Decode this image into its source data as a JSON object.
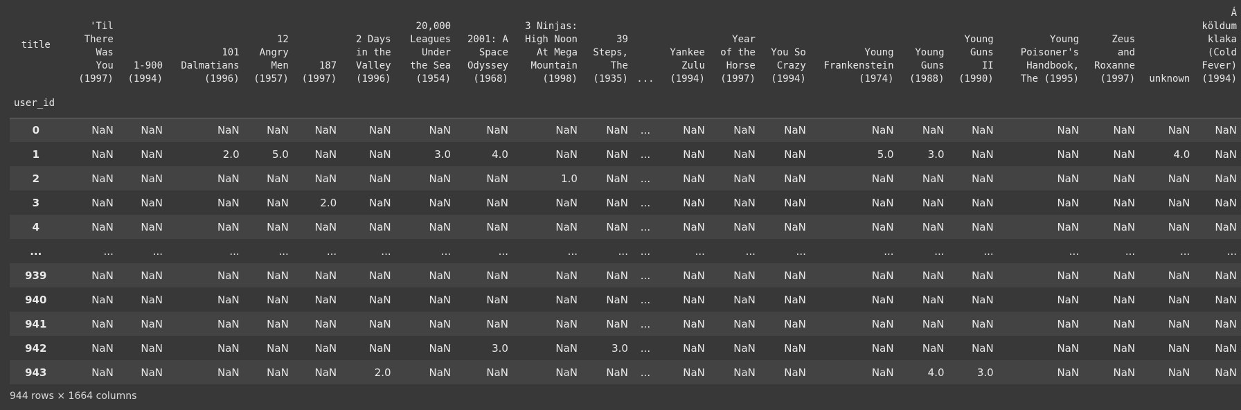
{
  "table": {
    "corner_label": "title",
    "index_name": "user_id",
    "columns": [
      "'Til\nThere\nWas\nYou\n(1997)",
      "1-900\n(1994)",
      "101\nDalmatians\n(1996)",
      "12\nAngry\nMen\n(1957)",
      "187\n(1997)",
      "2 Days\nin the\nValley\n(1996)",
      "20,000\nLeagues\nUnder\nthe Sea\n(1954)",
      "2001: A\nSpace\nOdyssey\n(1968)",
      "3 Ninjas:\nHigh Noon\nAt Mega\nMountain\n(1998)",
      "39\nSteps,\nThe\n(1935)",
      "...",
      "Yankee\nZulu\n(1994)",
      "Year\nof the\nHorse\n(1997)",
      "You So\nCrazy\n(1994)",
      "Young\nFrankenstein\n(1974)",
      "Young\nGuns\n(1988)",
      "Young\nGuns\nII\n(1990)",
      "Young\nPoisoner's\nHandbook,\nThe (1995)",
      "Zeus\nand\nRoxanne\n(1997)",
      "unknown",
      "Á\nköldum\nklaka\n(Cold\nFever)\n(1994)"
    ],
    "rows": [
      {
        "index": "0",
        "values": [
          "NaN",
          "NaN",
          "NaN",
          "NaN",
          "NaN",
          "NaN",
          "NaN",
          "NaN",
          "NaN",
          "NaN",
          "...",
          "NaN",
          "NaN",
          "NaN",
          "NaN",
          "NaN",
          "NaN",
          "NaN",
          "NaN",
          "NaN",
          "NaN"
        ]
      },
      {
        "index": "1",
        "values": [
          "NaN",
          "NaN",
          "2.0",
          "5.0",
          "NaN",
          "NaN",
          "3.0",
          "4.0",
          "NaN",
          "NaN",
          "...",
          "NaN",
          "NaN",
          "NaN",
          "5.0",
          "3.0",
          "NaN",
          "NaN",
          "NaN",
          "4.0",
          "NaN"
        ]
      },
      {
        "index": "2",
        "values": [
          "NaN",
          "NaN",
          "NaN",
          "NaN",
          "NaN",
          "NaN",
          "NaN",
          "NaN",
          "1.0",
          "NaN",
          "...",
          "NaN",
          "NaN",
          "NaN",
          "NaN",
          "NaN",
          "NaN",
          "NaN",
          "NaN",
          "NaN",
          "NaN"
        ]
      },
      {
        "index": "3",
        "values": [
          "NaN",
          "NaN",
          "NaN",
          "NaN",
          "2.0",
          "NaN",
          "NaN",
          "NaN",
          "NaN",
          "NaN",
          "...",
          "NaN",
          "NaN",
          "NaN",
          "NaN",
          "NaN",
          "NaN",
          "NaN",
          "NaN",
          "NaN",
          "NaN"
        ]
      },
      {
        "index": "4",
        "values": [
          "NaN",
          "NaN",
          "NaN",
          "NaN",
          "NaN",
          "NaN",
          "NaN",
          "NaN",
          "NaN",
          "NaN",
          "...",
          "NaN",
          "NaN",
          "NaN",
          "NaN",
          "NaN",
          "NaN",
          "NaN",
          "NaN",
          "NaN",
          "NaN"
        ]
      },
      {
        "index": "...",
        "values": [
          "...",
          "...",
          "...",
          "...",
          "...",
          "...",
          "...",
          "...",
          "...",
          "...",
          "...",
          "...",
          "...",
          "...",
          "...",
          "...",
          "...",
          "...",
          "...",
          "...",
          "..."
        ]
      },
      {
        "index": "939",
        "values": [
          "NaN",
          "NaN",
          "NaN",
          "NaN",
          "NaN",
          "NaN",
          "NaN",
          "NaN",
          "NaN",
          "NaN",
          "...",
          "NaN",
          "NaN",
          "NaN",
          "NaN",
          "NaN",
          "NaN",
          "NaN",
          "NaN",
          "NaN",
          "NaN"
        ]
      },
      {
        "index": "940",
        "values": [
          "NaN",
          "NaN",
          "NaN",
          "NaN",
          "NaN",
          "NaN",
          "NaN",
          "NaN",
          "NaN",
          "NaN",
          "...",
          "NaN",
          "NaN",
          "NaN",
          "NaN",
          "NaN",
          "NaN",
          "NaN",
          "NaN",
          "NaN",
          "NaN"
        ]
      },
      {
        "index": "941",
        "values": [
          "NaN",
          "NaN",
          "NaN",
          "NaN",
          "NaN",
          "NaN",
          "NaN",
          "NaN",
          "NaN",
          "NaN",
          "...",
          "NaN",
          "NaN",
          "NaN",
          "NaN",
          "NaN",
          "NaN",
          "NaN",
          "NaN",
          "NaN",
          "NaN"
        ]
      },
      {
        "index": "942",
        "values": [
          "NaN",
          "NaN",
          "NaN",
          "NaN",
          "NaN",
          "NaN",
          "NaN",
          "3.0",
          "NaN",
          "3.0",
          "...",
          "NaN",
          "NaN",
          "NaN",
          "NaN",
          "NaN",
          "NaN",
          "NaN",
          "NaN",
          "NaN",
          "NaN"
        ]
      },
      {
        "index": "943",
        "values": [
          "NaN",
          "NaN",
          "NaN",
          "NaN",
          "NaN",
          "2.0",
          "NaN",
          "NaN",
          "NaN",
          "NaN",
          "...",
          "NaN",
          "NaN",
          "NaN",
          "NaN",
          "4.0",
          "3.0",
          "NaN",
          "NaN",
          "NaN",
          "NaN"
        ]
      }
    ],
    "footer": "944 rows × 1664 columns"
  },
  "colors": {
    "background": "#383838",
    "row_alt": "#434343",
    "text": "#e6e6e6"
  }
}
